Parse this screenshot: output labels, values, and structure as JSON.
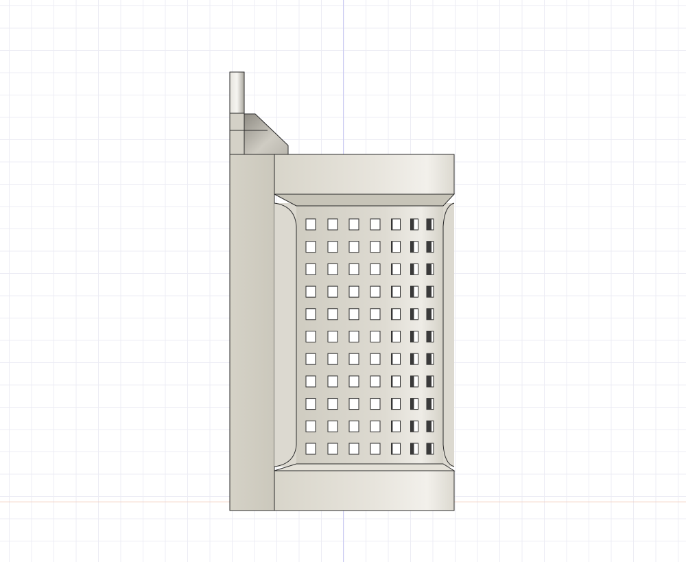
{
  "viewport": {
    "background": "#ffffff",
    "grid_minor_color": "#ececf4",
    "grid_major_color": "#d6d6e6",
    "axis_vertical_color": "#c9c9f2",
    "axis_horizontal_color": "#f2c9b8"
  },
  "model": {
    "description_icon": "perforated-cylinder-holder-model",
    "body_color": "#d9d6cc",
    "shade_color": "#cdcabd",
    "highlight_color": "#eeece6",
    "edge_color": "#2a2a2a",
    "hole_fill_color": "#ffffff",
    "hole_rows": 11,
    "hole_columns": 7
  }
}
